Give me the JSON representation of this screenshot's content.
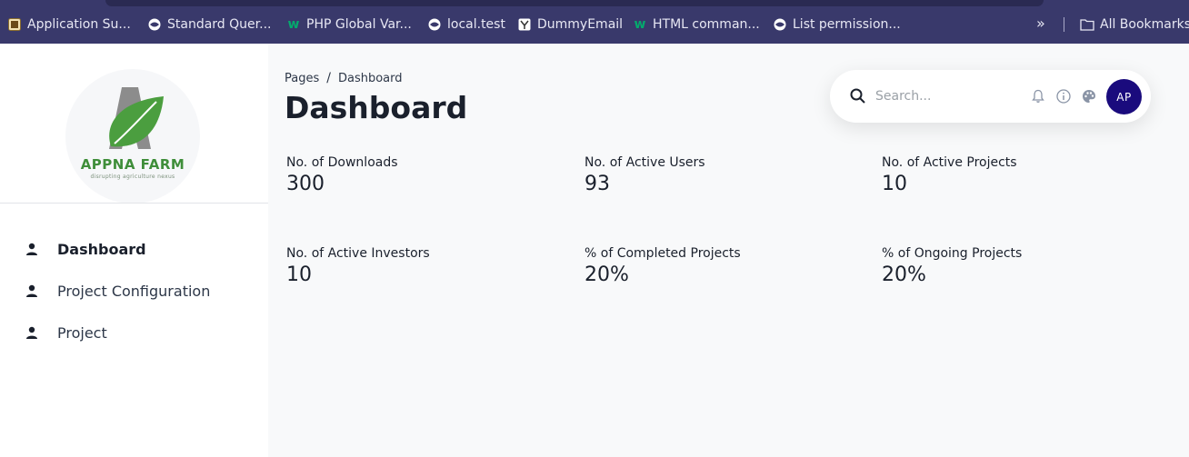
{
  "bookmarks": [
    {
      "label": "Application Su...",
      "icon": "app-icon"
    },
    {
      "label": "Standard Quer...",
      "icon": "globe-icon"
    },
    {
      "label": "PHP Global Var...",
      "icon": "w3-icon"
    },
    {
      "label": "local.test",
      "icon": "globe-icon"
    },
    {
      "label": "DummyEmail",
      "icon": "y-icon"
    },
    {
      "label": "HTML comman...",
      "icon": "w3-icon"
    },
    {
      "label": "List permission...",
      "icon": "globe-icon"
    }
  ],
  "bookmarks_more": "»",
  "all_bookmarks": "All Bookmarks",
  "logo": {
    "name": "APPNA FARM",
    "tagline": "disrupting agriculture nexus"
  },
  "sidebar": {
    "items": [
      {
        "label": "Dashboard",
        "active": true
      },
      {
        "label": "Project Configuration",
        "active": false
      },
      {
        "label": "Project",
        "active": false
      }
    ]
  },
  "breadcrumb": {
    "root": "Pages",
    "separator": "/",
    "current": "Dashboard"
  },
  "page_title": "Dashboard",
  "search": {
    "placeholder": "Search..."
  },
  "user": {
    "initials": "AP"
  },
  "stats": [
    {
      "label": "No. of Downloads",
      "value": "300"
    },
    {
      "label": "No. of Active Users",
      "value": "93"
    },
    {
      "label": "No. of Active Projects",
      "value": "10"
    },
    {
      "label": "No. of Active Investors",
      "value": "10"
    },
    {
      "label": "% of Completed Projects",
      "value": "20%"
    },
    {
      "label": "% of Ongoing Projects",
      "value": "20%"
    }
  ],
  "colors": {
    "bookmarks_bar": "#39396b",
    "avatar": "#1a0b7d",
    "logo_green": "#3f8e3a"
  }
}
